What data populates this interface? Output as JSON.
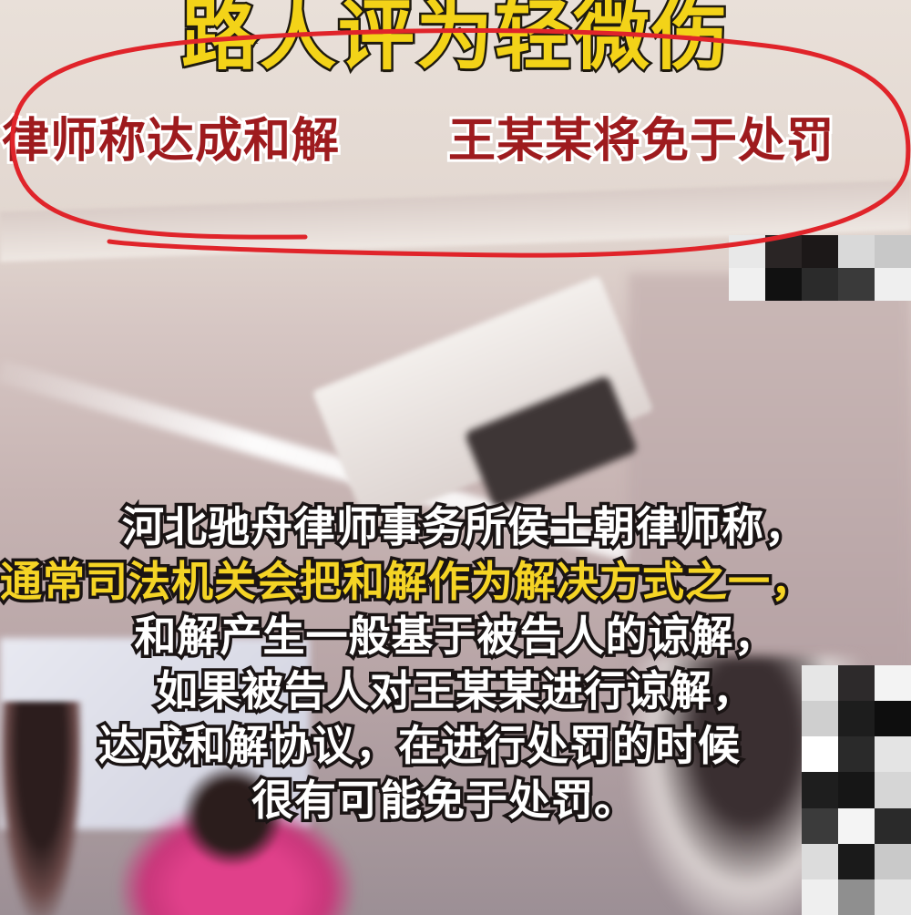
{
  "headline": {
    "text": "路人评为轻微伤"
  },
  "subline": {
    "part1": "律师称达成和解",
    "part2": "王某某将免于处罚"
  },
  "caption": {
    "lines": [
      "河北驰舟律师事务所侯士朝律师称，",
      "通常司法机关会把和解作为解决方式之一，",
      "和解产生一般基于被告人的谅解，",
      "如果被告人对王某某进行谅解，",
      "达成和解协议，在进行处罚的时候",
      "很有可能免于处罚。"
    ]
  },
  "colors": {
    "headline_fill": "#f3d318",
    "subline_fill": "#9e1b1e",
    "annotation_oval": "#e0242a",
    "caption_fill": "#ffffff",
    "caption_highlight": "#f5d425"
  },
  "mosaic": {
    "top": [
      "#e8e8e8",
      "#2a2525",
      "#1c1818",
      "#d9d9d9",
      "#c8c8c8",
      "#f0f0f0",
      "#111111",
      "#2b2b2b",
      "#3a3a3a",
      "#efefef"
    ],
    "right": [
      "#e6e6e6",
      "#2d2a2b",
      "#f3f3f3",
      "#cfcfcf",
      "#1d1d1d",
      "#0e0e0e",
      "#ffffff",
      "#2a2a2a",
      "#e4e4e4",
      "#1e1e1e",
      "#161616",
      "#d6d6d6",
      "#3b3b3b",
      "#f4f4f4",
      "#2a2a2a",
      "#dcdcdc",
      "#1a1a1a",
      "#c9c9c9",
      "#efefef",
      "#8f8f8f",
      "#e5e5e5"
    ]
  }
}
